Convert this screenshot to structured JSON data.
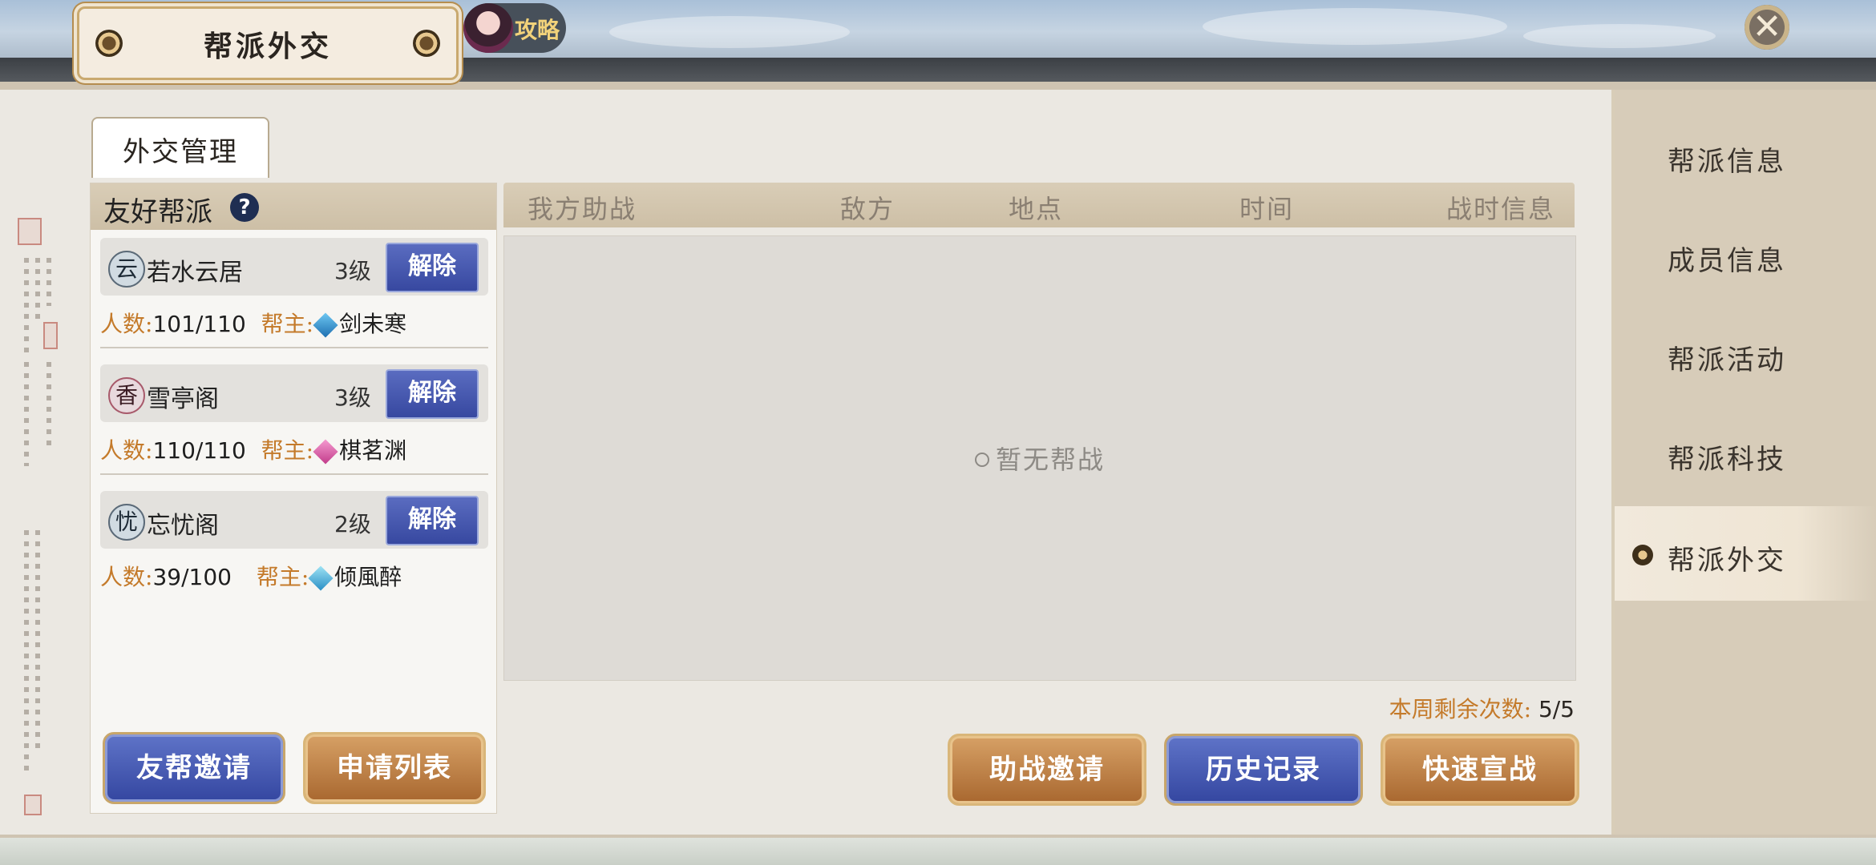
{
  "header": {
    "title": "帮派外交",
    "guide_label": "攻略",
    "close_glyph": "✕"
  },
  "sub_tab": {
    "label": "外交管理"
  },
  "friendly": {
    "header": "友好帮派",
    "help_glyph": "?",
    "members_label": "人数:",
    "leader_label": "帮主:",
    "remove_label": "解除",
    "guilds": [
      {
        "emblem": "云",
        "name": "若水云居",
        "level": "3级",
        "members": "101/110",
        "leader": "剑未寒",
        "gem_color": "blue"
      },
      {
        "emblem": "香",
        "name": "雪亭阁",
        "level": "3级",
        "members": "110/110",
        "leader": "棋茗渊",
        "gem_color": "pink"
      },
      {
        "emblem": "忧",
        "name": "忘忧阁",
        "level": "2级",
        "members": "39/100",
        "leader": "倾風醉",
        "gem_color": "cyan"
      }
    ],
    "invite_button": "友帮邀请",
    "requests_button": "申请列表"
  },
  "war_table": {
    "columns": [
      "我方助战",
      "敌方",
      "地点",
      "时间",
      "战时信息"
    ],
    "empty_text": "暂无帮战",
    "remaining_label": "本周剩余次数:",
    "remaining_value": "5/5"
  },
  "actions": {
    "assist_invite": "助战邀请",
    "history": "历史记录",
    "quick_declare": "快速宣战"
  },
  "side_nav": {
    "items": [
      "帮派信息",
      "成员信息",
      "帮派活动",
      "帮派科技",
      "帮派外交"
    ],
    "active_index": 4
  }
}
